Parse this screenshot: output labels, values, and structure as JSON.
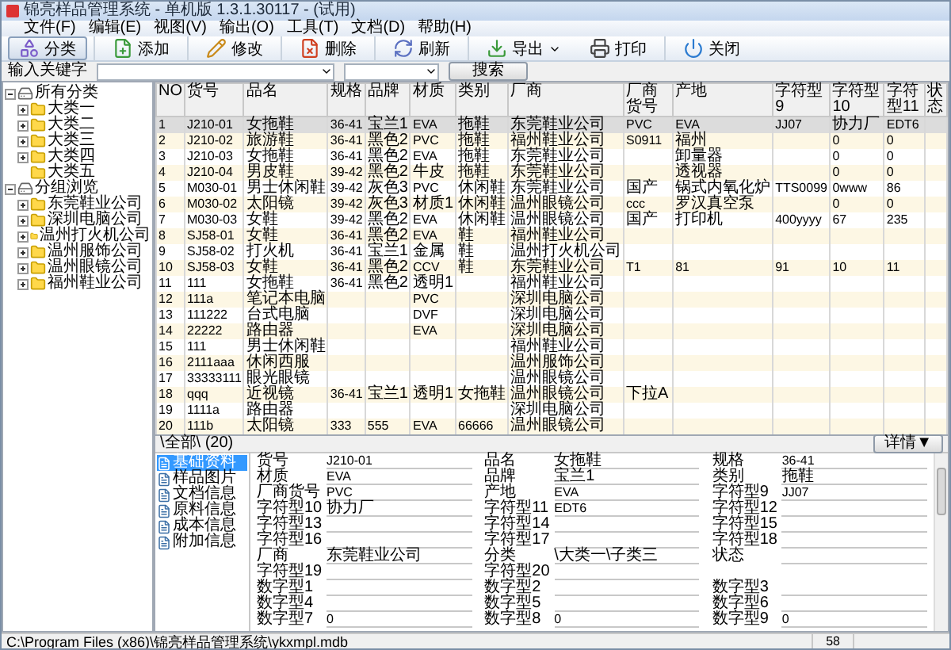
{
  "window": {
    "title": "锦亮样品管理系统 - 单机版 1.3.1.30117 - (试用)"
  },
  "menu": [
    "文件(F)",
    "编辑(E)",
    "视图(V)",
    "输出(O)",
    "工具(T)",
    "文档(D)",
    "帮助(H)"
  ],
  "toolbar": [
    {
      "label": "分类",
      "kind": "category",
      "selected": true
    },
    {
      "label": "添加",
      "kind": "add",
      "selected": false
    },
    {
      "label": "修改",
      "kind": "edit",
      "selected": false
    },
    {
      "label": "删除",
      "kind": "delete",
      "selected": false
    },
    {
      "label": "刷新",
      "kind": "refresh",
      "selected": false
    },
    {
      "label": "导出",
      "kind": "export",
      "selected": false
    },
    {
      "label": "打印",
      "kind": "print",
      "selected": false
    },
    {
      "label": "关闭",
      "kind": "close",
      "selected": false
    }
  ],
  "search": {
    "label": "输入关键字",
    "button": "搜索"
  },
  "tree": [
    {
      "label": "所有分类",
      "expanded": true,
      "leaf": false,
      "children": [
        {
          "label": "大类一",
          "expanded": false,
          "leaf": false
        },
        {
          "label": "大类二",
          "expanded": false,
          "leaf": false
        },
        {
          "label": "大类三",
          "expanded": false,
          "leaf": false
        },
        {
          "label": "大类四",
          "expanded": false,
          "leaf": false
        },
        {
          "label": "大类五",
          "expanded": false,
          "leaf": true
        }
      ]
    },
    {
      "label": "分组浏览",
      "expanded": true,
      "leaf": false,
      "children": [
        {
          "label": "东莞鞋业公司",
          "expanded": false,
          "leaf": false
        },
        {
          "label": "深圳电脑公司",
          "expanded": false,
          "leaf": false
        },
        {
          "label": "温州打火机公司",
          "expanded": false,
          "leaf": false
        },
        {
          "label": "温州服饰公司",
          "expanded": false,
          "leaf": false
        },
        {
          "label": "温州眼镜公司",
          "expanded": false,
          "leaf": false
        },
        {
          "label": "福州鞋业公司",
          "expanded": false,
          "leaf": false
        }
      ]
    }
  ],
  "table": {
    "columns": [
      "NO",
      "货号",
      "品名",
      "规格",
      "品牌",
      "材质",
      "类别",
      "厂商",
      "厂商货号",
      "产地",
      "字符型9",
      "字符型10",
      "字符型11",
      "状态"
    ],
    "rows": [
      {
        "selected": true,
        "cells": [
          "1",
          "J210-01",
          "女拖鞋",
          "36-41",
          "宝兰1",
          "EVA",
          "拖鞋",
          "东莞鞋业公司",
          "PVC",
          "EVA",
          "JJ07",
          "协力厂",
          "EDT6",
          null
        ]
      },
      {
        "selected": false,
        "cells": [
          "2",
          "J210-02",
          "旅游鞋",
          "36-41",
          "黑色2",
          "PVC",
          "拖鞋",
          "福州鞋业公司",
          "S0911",
          "福州",
          null,
          "0",
          "0",
          null
        ]
      },
      {
        "selected": false,
        "cells": [
          "3",
          "J210-03",
          "女拖鞋",
          "36-41",
          "黑色2",
          "EVA",
          "拖鞋",
          "东莞鞋业公司",
          null,
          "卸量器",
          null,
          "0",
          "0",
          null
        ]
      },
      {
        "selected": false,
        "cells": [
          "4",
          "J210-04",
          "男皮鞋",
          "39-42",
          "黑色2",
          "牛皮",
          "拖鞋",
          "东莞鞋业公司",
          null,
          "透视器",
          null,
          "0",
          "0",
          null
        ]
      },
      {
        "selected": false,
        "cells": [
          "5",
          "M030-01",
          "男士休闲鞋",
          "39-42",
          "灰色3",
          "PVC",
          "休闲鞋",
          "东莞鞋业公司",
          "国产",
          "锅式内氧化炉",
          "TTS0099",
          "0www",
          "86",
          null
        ]
      },
      {
        "selected": false,
        "cells": [
          "6",
          "M030-02",
          "太阳镜",
          "39-42",
          "灰色3",
          "材质1",
          "休闲鞋",
          "温州眼镜公司",
          "ccc",
          "罗汉真空泵",
          null,
          "0",
          "0",
          null
        ]
      },
      {
        "selected": false,
        "cells": [
          "7",
          "M030-03",
          "女鞋",
          "39-42",
          "黑色2",
          "EVA",
          "休闲鞋",
          "温州眼镜公司",
          "国产",
          "打印机",
          "400yyyy",
          "67",
          "235",
          null
        ]
      },
      {
        "selected": false,
        "cells": [
          "8",
          "SJ58-01",
          "女鞋",
          "36-41",
          "黑色2",
          "EVA",
          "鞋",
          "福州鞋业公司",
          null,
          null,
          null,
          null,
          null,
          null
        ]
      },
      {
        "selected": false,
        "cells": [
          "9",
          "SJ58-02",
          "打火机",
          "36-41",
          "宝兰1",
          "金属",
          "鞋",
          "温州打火机公司",
          null,
          null,
          null,
          null,
          null,
          null
        ]
      },
      {
        "selected": false,
        "cells": [
          "10",
          "SJ58-03",
          "女鞋",
          "36-41",
          "黑色2",
          "CCV",
          "鞋",
          "东莞鞋业公司",
          "T1",
          "81",
          "91",
          "10",
          "11",
          null
        ]
      },
      {
        "selected": false,
        "cells": [
          "11",
          "111",
          "女拖鞋",
          "36-41",
          "黑色2",
          "透明1",
          null,
          "福州鞋业公司",
          null,
          null,
          null,
          null,
          null,
          null
        ]
      },
      {
        "selected": false,
        "cells": [
          "12",
          "111a",
          "笔记本电脑",
          null,
          null,
          "PVC",
          null,
          "深圳电脑公司",
          null,
          null,
          null,
          null,
          null,
          null
        ]
      },
      {
        "selected": false,
        "cells": [
          "13",
          "111222",
          "台式电脑",
          null,
          null,
          "DVF",
          null,
          "深圳电脑公司",
          null,
          null,
          null,
          null,
          null,
          null
        ]
      },
      {
        "selected": false,
        "cells": [
          "14",
          "22222",
          "路由器",
          null,
          null,
          "EVA",
          null,
          "深圳电脑公司",
          null,
          null,
          null,
          null,
          null,
          null
        ]
      },
      {
        "selected": false,
        "cells": [
          "15",
          "111",
          "男士休闲鞋",
          null,
          null,
          null,
          null,
          "福州鞋业公司",
          null,
          null,
          null,
          null,
          null,
          null
        ]
      },
      {
        "selected": false,
        "cells": [
          "16",
          "2111aaa",
          "休闲西服",
          null,
          null,
          null,
          null,
          "温州服饰公司",
          null,
          null,
          null,
          null,
          null,
          null
        ]
      },
      {
        "selected": false,
        "cells": [
          "17",
          "33333111",
          "眼光眼镜",
          null,
          null,
          null,
          null,
          "温州眼镜公司",
          null,
          null,
          null,
          null,
          null,
          null
        ]
      },
      {
        "selected": false,
        "cells": [
          "18",
          "qqq",
          "近视镜",
          "36-41",
          "宝兰1",
          "透明1",
          "女拖鞋",
          "温州眼镜公司",
          "下拉A",
          null,
          null,
          null,
          null,
          null
        ]
      },
      {
        "selected": false,
        "cells": [
          "19",
          "1111a",
          "路由器",
          null,
          null,
          null,
          null,
          "深圳电脑公司",
          null,
          null,
          null,
          null,
          null,
          null
        ]
      },
      {
        "selected": false,
        "cells": [
          "20",
          "111b",
          "太阳镜",
          "333",
          "555",
          "EVA",
          "66666",
          "温州眼镜公司",
          null,
          null,
          null,
          null,
          null,
          null
        ]
      }
    ]
  },
  "detail": {
    "path": "\\全部\\ (20)",
    "button": "详情▼"
  },
  "detail_tabs": [
    {
      "label": "基础资料",
      "selected": true
    },
    {
      "label": "样品图片",
      "selected": false
    },
    {
      "label": "文档信息",
      "selected": false
    },
    {
      "label": "原料信息",
      "selected": false
    },
    {
      "label": "成本信息",
      "selected": false
    },
    {
      "label": "附加信息",
      "selected": false
    }
  ],
  "form": [
    [
      {
        "label": "货号",
        "value": "J210-01"
      },
      {
        "label": "品名",
        "value": "女拖鞋"
      },
      {
        "label": "规格",
        "value": "36-41"
      }
    ],
    [
      {
        "label": "材质",
        "value": "EVA"
      },
      {
        "label": "品牌",
        "value": "宝兰1"
      },
      {
        "label": "类别",
        "value": "拖鞋"
      }
    ],
    [
      {
        "label": "厂商货号",
        "value": "PVC"
      },
      {
        "label": "产地",
        "value": "EVA"
      },
      {
        "label": "字符型9",
        "value": "JJ07"
      }
    ],
    [
      {
        "label": "字符型10",
        "value": "协力厂"
      },
      {
        "label": "字符型11",
        "value": "EDT6"
      },
      {
        "label": "字符型12"
      }
    ],
    [
      {
        "label": "字符型13"
      },
      {
        "label": "字符型14"
      },
      {
        "label": "字符型15"
      }
    ],
    [
      {
        "label": "字符型16"
      },
      {
        "label": "字符型17"
      },
      {
        "label": "字符型18"
      }
    ],
    [
      {
        "label": "厂商",
        "value": "东莞鞋业公司"
      },
      {
        "label": "分类",
        "value": "\\大类一\\子类三"
      },
      {
        "label": "状态"
      }
    ],
    [
      {
        "label": "字符型19"
      },
      {
        "label": "字符型20"
      }
    ],
    [
      {
        "label": "数字型1"
      },
      {
        "label": "数字型2"
      },
      {
        "label": "数字型3"
      }
    ],
    [
      {
        "label": "数字型4"
      },
      {
        "label": "数字型5"
      },
      {
        "label": "数字型6"
      }
    ],
    [
      {
        "label": "数字型7",
        "value": "0"
      },
      {
        "label": "数字型8",
        "value": "0"
      },
      {
        "label": "数字型9",
        "value": "0"
      }
    ]
  ],
  "status_bar": {
    "path": "C:\\Program Files (x86)\\锦亮样品管理系统\\ykxmpl.mdb",
    "count": "58"
  }
}
